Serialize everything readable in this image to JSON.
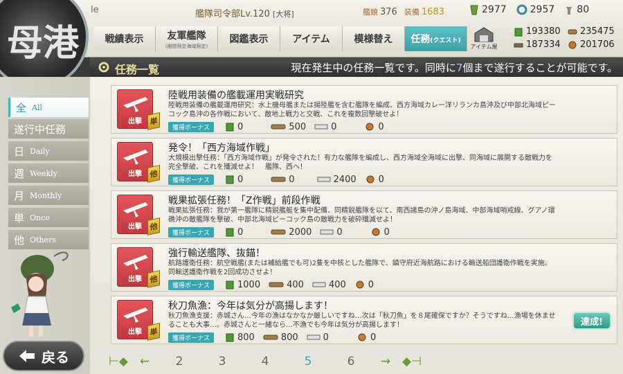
{
  "header": {
    "admiral_name": "le",
    "hq_label": "艦隊司令部Lv.",
    "hq_level": "120",
    "rank": "[大将]",
    "ships_label": "艦娘",
    "ships_count": "376",
    "equip_label": "装備",
    "equip_count": "1683",
    "bucket": "2977",
    "dev_material": "2957",
    "screw": "80",
    "resources": {
      "fuel": "193380",
      "ammo": "235475",
      "steel": "187334",
      "bauxite": "201706"
    },
    "akashi_label": "アイテム屋"
  },
  "nav": {
    "tabs": [
      {
        "label": "戦績表示",
        "sub": ""
      },
      {
        "label": "友軍艦隊",
        "sub": "(期間限定海域限定)"
      },
      {
        "label": "図鑑表示",
        "sub": ""
      },
      {
        "label": "アイテム",
        "sub": ""
      },
      {
        "label": "模様替え",
        "sub": ""
      },
      {
        "label": "任務",
        "sub": "(クエスト)"
      }
    ]
  },
  "emblem_text": "母港",
  "title": {
    "main": "任務一覧",
    "desc_before": "現在発生中の任務一覧です。同時に",
    "desc_number": "7",
    "desc_after": "個まで遂行することが可能です。"
  },
  "sidebar": {
    "filters": [
      {
        "jp": "全",
        "en": "All"
      },
      {
        "jp": "遂行中任務",
        "en": ""
      },
      {
        "jp": "日",
        "en": "Daily"
      },
      {
        "jp": "週",
        "en": "Weekly"
      },
      {
        "jp": "月",
        "en": "Monthly"
      },
      {
        "jp": "単",
        "en": "Once"
      },
      {
        "jp": "他",
        "en": "Others"
      }
    ],
    "back_label": "戻る"
  },
  "quests": [
    {
      "category": "出撃",
      "badge": "単",
      "title": "陸戦用装備の艦載運用実戦研究",
      "desc": "陸戦用装備の艦載運用研究：水上機母艦または揚陸艦を含む艦隊を編成、西方海域カレー洋リランカ島沖及び中部北海域ピーコック島沖の各作戦において、敵地上戦力と交戦、これを複数回撃破せよ！",
      "bonus_label": "獲得ボーナス",
      "fuel": "0",
      "ammo": "500",
      "steel": "0",
      "bauxite": "0",
      "completed": ""
    },
    {
      "category": "出撃",
      "badge": "他",
      "title": "発令！「西方海域作戦」",
      "desc": "大規模出撃任務：「西方海域作戦」が発令された！有力な艦隊を編成し、西方海域全海域に出撃、同海域に展開する敵戦力を完全撃破、これを殲滅せよ！　艦隊、西へ！",
      "bonus_label": "獲得ボーナス",
      "fuel": "0",
      "ammo": "0",
      "steel": "2400",
      "bauxite": "0",
      "completed": ""
    },
    {
      "category": "出撃",
      "badge": "他",
      "title": "戦果拡張任務！「Z作戦」前段作戦",
      "desc": "戦果拡張任務：我が第一艦隊に精鋭艦艇を集中配備、同精鋭艦隊を以て、南西諸島の沖ノ島海域、中部海域哨戒線、グアノ環礁沖の敵艦隊を撃破、中部北海域ピーコック島の敵戦力を破砕殲滅せよ！",
      "bonus_label": "獲得ボーナス",
      "fuel": "0",
      "ammo": "2000",
      "steel": "0",
      "bauxite": "0",
      "completed": ""
    },
    {
      "category": "出撃",
      "badge": "他",
      "title": "強行輸送艦隊、抜錨！",
      "desc": "航路護衛任務：航空戦艦(または補給艦でも可)2隻を中核とした艦隊で、鎮守府近海航路における輸送船団護衛作戦を実施。同輸送護衛作戦を2回成功させよ！",
      "bonus_label": "獲得ボーナス",
      "fuel": "1000",
      "ammo": "400",
      "steel": "400",
      "bauxite": "0",
      "completed": ""
    },
    {
      "category": "出撃",
      "badge": "単",
      "title": "秋刀魚漁：今年は気分が高揚します！",
      "desc": "秋刀魚漁支援：赤城さん…今年の漁はなかなか厳しいですね…次は「秋刀魚」を８尾確保ですか？そうですね…漁場を休ませることも大事…。赤城さんと一緒なら…不漁でも今年は気分が高揚します！",
      "bonus_label": "獲得ボーナス",
      "fuel": "800",
      "ammo": "800",
      "steel": "0",
      "bauxite": "0",
      "completed": "達成!"
    }
  ],
  "pager": {
    "pages": [
      "2",
      "3",
      "4",
      "5",
      "6"
    ],
    "current": "5"
  },
  "colors": {
    "accent": "#3aa6b1",
    "sortie_red": "#c23a3e",
    "title_gold": "#e8d79a"
  }
}
